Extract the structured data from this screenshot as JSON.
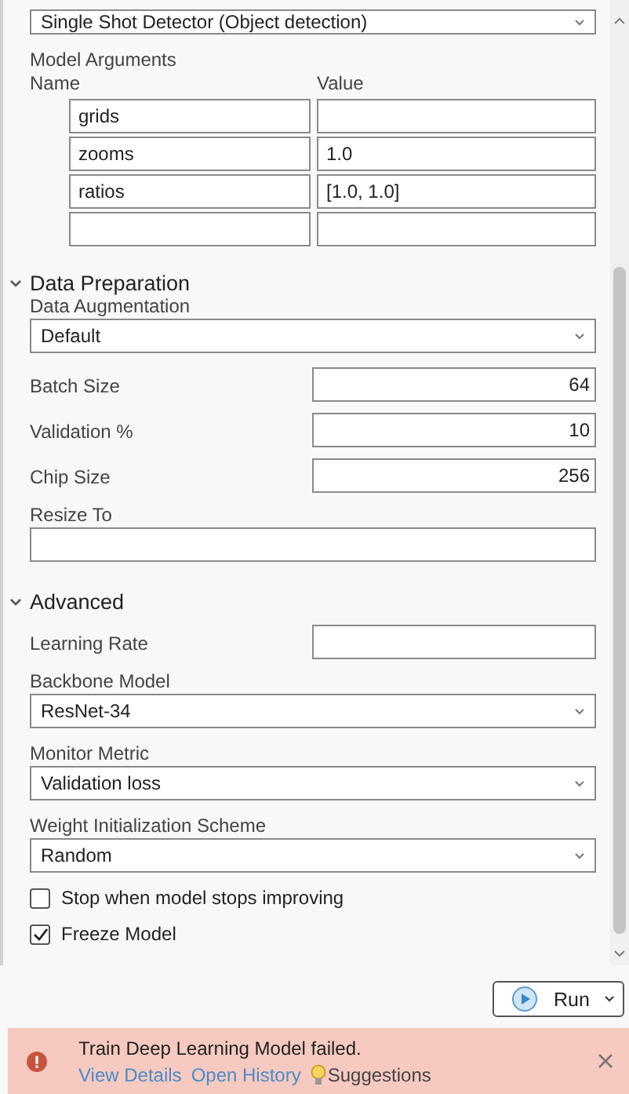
{
  "model_type": {
    "value": "Single Shot Detector (Object detection)"
  },
  "model_arguments": {
    "label": "Model Arguments",
    "columns": [
      "Name",
      "Value"
    ],
    "rows": [
      {
        "name": "grids",
        "value": ""
      },
      {
        "name": "zooms",
        "value": "1.0"
      },
      {
        "name": "ratios",
        "value": "[1.0, 1.0]"
      },
      {
        "name": "",
        "value": ""
      }
    ]
  },
  "sections": [
    {
      "title": "Data Preparation",
      "expanded": true,
      "fields": [
        {
          "kind": "dropdown",
          "label": "Data Augmentation",
          "value": "Default"
        },
        {
          "kind": "number",
          "label": "Batch Size",
          "value": "64"
        },
        {
          "kind": "number",
          "label": "Validation %",
          "value": "10"
        },
        {
          "kind": "number",
          "label": "Chip Size",
          "value": "256"
        },
        {
          "kind": "text",
          "label": "Resize To"
        }
      ]
    },
    {
      "title": "Advanced",
      "expanded": true,
      "fields": [
        {
          "kind": "number",
          "label": "Learning Rate"
        },
        {
          "kind": "dropdown",
          "label": "Backbone Model",
          "value": "ResNet-34"
        },
        {
          "kind": "dropdown",
          "label": "Monitor Metric",
          "value": "Validation loss"
        },
        {
          "kind": "dropdown",
          "label": "Weight Initialization Scheme",
          "value": "Random"
        },
        {
          "kind": "checkbox",
          "label": "Stop when model stops improving",
          "checked": false
        },
        {
          "kind": "checkbox",
          "label": "Freeze Model",
          "checked": true
        }
      ]
    }
  ],
  "run_button": {
    "label": "Run"
  },
  "error_banner": {
    "message": "Train Deep Learning Model failed.",
    "links": [
      "View Details",
      "Open History"
    ],
    "suggestions": "Suggestions"
  }
}
